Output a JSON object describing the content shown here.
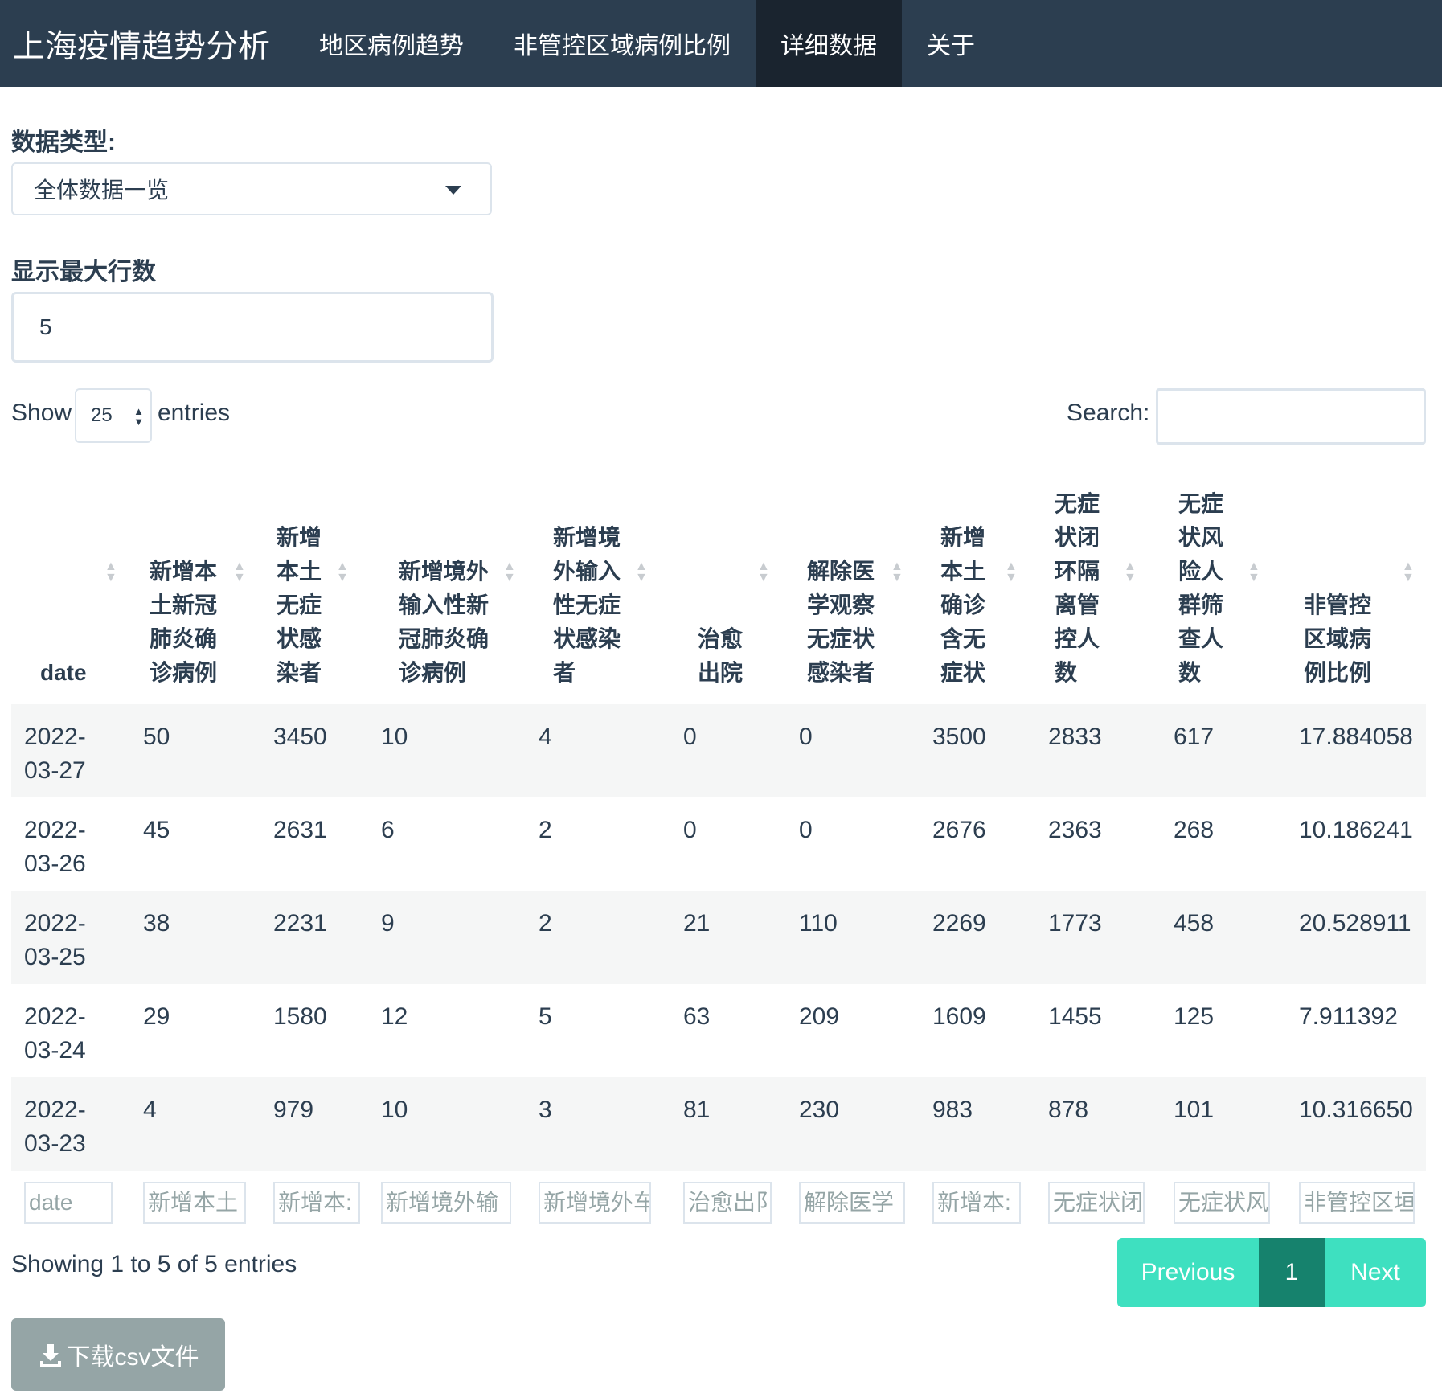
{
  "navbar": {
    "brand": "上海疫情趋势分析",
    "tabs": [
      "地区病例趋势",
      "非管控区域病例比例",
      "详细数据",
      "关于"
    ],
    "active_tab": "详细数据"
  },
  "controls": {
    "data_type_label": "数据类型:",
    "data_type_value": "全体数据一览",
    "max_rows_label": "显示最大行数",
    "max_rows_value": "5"
  },
  "table_controls": {
    "show_label": "Show",
    "entries_value": "25",
    "entries_label": "entries",
    "search_label": "Search:"
  },
  "table": {
    "columns": [
      "date",
      "新增本土新冠肺炎确诊病例",
      "新增本土无症状感染者",
      "新增境外输入性新冠肺炎确诊病例",
      "新增境外输入性无症状感染者",
      "治愈出院",
      "解除医学观察无症状感染者",
      "新增本土确诊含无症状",
      "无症状闭环隔离管控人数",
      "无症状风险人群筛查人数",
      "非管控区域病例比例"
    ],
    "rows": [
      [
        "2022-03-27",
        "50",
        "3450",
        "10",
        "4",
        "0",
        "0",
        "3500",
        "2833",
        "617",
        "17.884058"
      ],
      [
        "2022-03-26",
        "45",
        "2631",
        "6",
        "2",
        "0",
        "0",
        "2676",
        "2363",
        "268",
        "10.186241"
      ],
      [
        "2022-03-25",
        "38",
        "2231",
        "9",
        "2",
        "21",
        "110",
        "2269",
        "1773",
        "458",
        "20.528911"
      ],
      [
        "2022-03-24",
        "29",
        "1580",
        "12",
        "5",
        "63",
        "209",
        "1609",
        "1455",
        "125",
        "7.911392"
      ],
      [
        "2022-03-23",
        "4",
        "979",
        "10",
        "3",
        "81",
        "230",
        "983",
        "878",
        "101",
        "10.316650"
      ]
    ],
    "filter_placeholders": [
      "date",
      "新增本土",
      "新增本:",
      "新增境外输",
      "新增境外车",
      "治愈出阝",
      "解除医学",
      "新增本:",
      "无症状闭",
      "无症状风",
      "非管控区垣"
    ]
  },
  "footer": {
    "info": "Showing 1 to 5 of 5 entries",
    "previous": "Previous",
    "current_page": "1",
    "next": "Next",
    "download_label": "下载csv文件"
  }
}
